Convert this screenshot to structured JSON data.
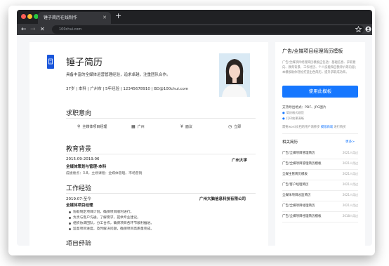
{
  "browser": {
    "tab_title": "锤子简历在线制作",
    "url": "100chui.com",
    "colors": {
      "dot_red": "#ff5f57",
      "dot_yellow": "#febc2e",
      "dot_green": "#28c840",
      "accent": "#1677ff"
    }
  },
  "resume": {
    "name": "锤子简历",
    "summary": "具备丰富的全媒体运营管理经验，追求卓越，注重团队合作。",
    "info": "37岁 | 本科 | 广州市 | 5年经验 | 12345678910 | BD@100chui.com",
    "intent": {
      "title": "求职意向",
      "items": [
        {
          "icon": "briefcase-icon",
          "label": "全媒体项目经理"
        },
        {
          "icon": "building-icon",
          "label": "广州"
        },
        {
          "icon": "yen-icon",
          "label": "面议"
        },
        {
          "icon": "clock-icon",
          "label": "立即"
        }
      ]
    },
    "education": {
      "title": "教育背景",
      "date": "2015.09-2019.06",
      "school": "广州大学",
      "major": "全媒体策划与管理-本科",
      "detail": "成绩绩点：3.8，主修课程：全媒体管理、市场营销"
    },
    "work": {
      "title": "工作经验",
      "date": "2019.07-至今",
      "company": "广州大脑信息科技有限公司",
      "role": "全媒体项目经理",
      "bullets": [
        "协助制定项目计划，确保项目顺利进行。",
        "负责与客户沟通，了解需求，提供专业建议。",
        "组织协调团队，分工合作，确保项目各环节顺利推进。",
        "监督项目进度，及时解决问题，确保项目高质量完成。"
      ]
    },
    "project": {
      "title": "项目经验"
    }
  },
  "sidebar": {
    "title": "广告/全媒项目经理简历模板",
    "desc": "广告/全媒项目经理简历模板应包括：基础信息、求职意向、教育背景、工作经历、个人技能和自我评价等内容；本模板助你轻松打造出色简历，提升求职成功率。",
    "use_button": "使用此模板",
    "formats": "支持导出格式：PDF、JPG图片",
    "feat1": "简历格式规范",
    "feat2": "打印效果清晰",
    "word_note": "需要word文档的用户请移步",
    "word_link": "模版商城",
    "word_tail": "进行购买",
    "related_title": "相关简历",
    "more": "更多>",
    "related": [
      {
        "name": "广告/全媒项目管理简历",
        "count": "2021人用过"
      },
      {
        "name": "广告/全媒项目管理简历模板",
        "count": "2021人用过"
      },
      {
        "name": "全媒主管简历模板",
        "count": "2021人用过"
      },
      {
        "name": "广告/客户经理简历",
        "count": "2021人用过"
      },
      {
        "name": "全媒体项目总监简历",
        "count": "2021人用过"
      },
      {
        "name": "广告/全媒项目经理简历",
        "count": "2021人用过"
      },
      {
        "name": "广告/全媒项目经理简历模板",
        "count": "2018人用过"
      }
    ]
  }
}
